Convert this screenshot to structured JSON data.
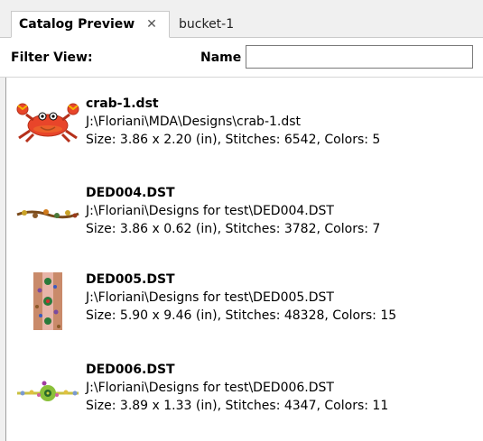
{
  "tabs": [
    {
      "label": "Catalog Preview",
      "active": true
    },
    {
      "label": "bucket-1",
      "active": false
    }
  ],
  "filter": {
    "filter_view_label": "Filter View:",
    "name_label": "Name",
    "name_value": "",
    "name_placeholder": ""
  },
  "items": [
    {
      "name": "crab-1.dst",
      "path": "J:\\Floriani\\MDA\\Designs\\crab-1.dst",
      "stats": "Size: 3.86 x 2.20 (in), Stitches: 6542, Colors: 5",
      "thumb_icon": "crab-icon"
    },
    {
      "name": "DED004.DST",
      "path": "J:\\Floriani\\Designs for test\\DED004.DST",
      "stats": "Size: 3.86 x 0.62 (in), Stitches: 3782, Colors: 7",
      "thumb_icon": "floral-border-icon"
    },
    {
      "name": "DED005.DST",
      "path": "J:\\Floriani\\Designs for test\\DED005.DST",
      "stats": "Size: 5.90 x 9.46 (in), Stitches: 48328, Colors: 15",
      "thumb_icon": "floral-panel-icon"
    },
    {
      "name": "DED006.DST",
      "path": "J:\\Floriani\\Designs for test\\DED006.DST",
      "stats": "Size: 3.89 x 1.33 (in), Stitches: 4347, Colors: 11",
      "thumb_icon": "flower-border-icon"
    }
  ],
  "colors": {
    "crab": "#e8452a",
    "accent_border": "#c9c9c9"
  }
}
